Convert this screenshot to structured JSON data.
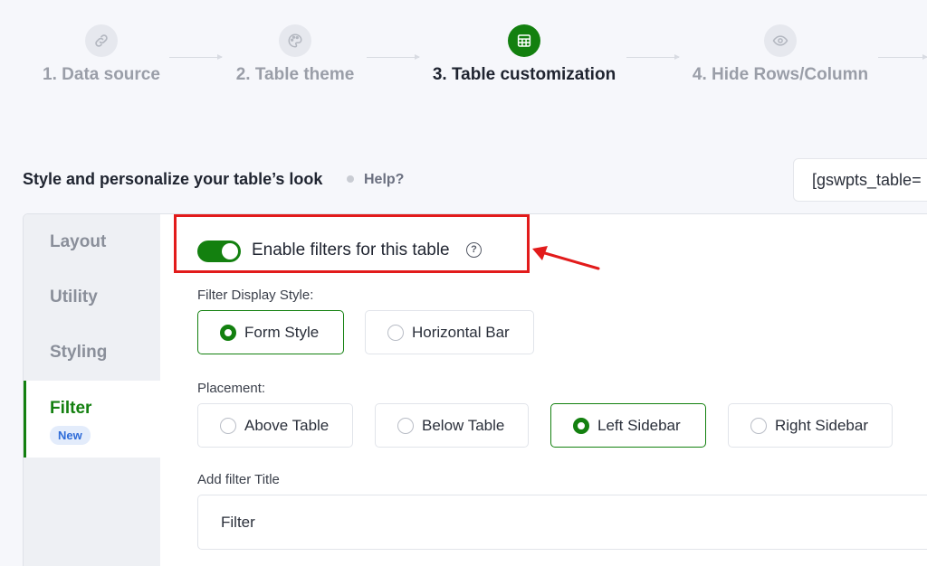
{
  "stepper": {
    "steps": [
      {
        "label": "1. Data source",
        "icon": "link-icon",
        "state": "inactive"
      },
      {
        "label": "2. Table theme",
        "icon": "palette-icon",
        "state": "inactive"
      },
      {
        "label": "3. Table customization",
        "icon": "table-grid-icon",
        "state": "active"
      },
      {
        "label": "4. Hide Rows/Column",
        "icon": "eye-icon",
        "state": "inactive"
      }
    ]
  },
  "header": {
    "title": "Style and personalize your table’s look",
    "help_label": "Help?",
    "shortcode": "[gswpts_table="
  },
  "sidebar": {
    "items": [
      {
        "label": "Layout"
      },
      {
        "label": "Utility"
      },
      {
        "label": "Styling"
      },
      {
        "label": "Filter",
        "badge": "New",
        "active": true
      }
    ]
  },
  "filter_panel": {
    "enable_label": "Enable filters for this table",
    "enable_on": true,
    "display_style_label": "Filter Display Style:",
    "display_styles": [
      {
        "label": "Form Style",
        "selected": true
      },
      {
        "label": "Horizontal Bar",
        "selected": false
      }
    ],
    "placement_label": "Placement:",
    "placements": [
      {
        "label": "Above Table",
        "selected": false
      },
      {
        "label": "Below Table",
        "selected": false
      },
      {
        "label": "Left Sidebar",
        "selected": true
      },
      {
        "label": "Right Sidebar",
        "selected": false
      }
    ],
    "title_label": "Add filter Title",
    "title_value": "Filter"
  },
  "colors": {
    "accent": "#13800f",
    "highlight": "#e21b1b",
    "badge_bg": "#e3ecfb",
    "badge_text": "#2f6cd8"
  }
}
